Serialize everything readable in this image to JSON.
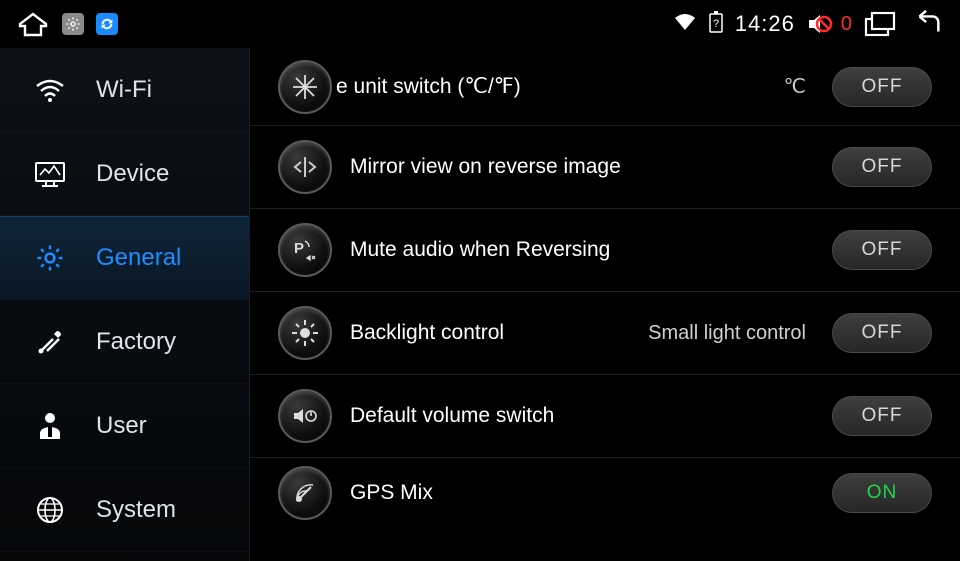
{
  "status": {
    "time": "14:26",
    "volume_count": "0"
  },
  "sidebar": {
    "items": [
      {
        "label": "Wi-Fi"
      },
      {
        "label": "Device"
      },
      {
        "label": "General"
      },
      {
        "label": "Factory"
      },
      {
        "label": "User"
      },
      {
        "label": "System"
      }
    ]
  },
  "settings": [
    {
      "label": "e unit switch (℃/℉)",
      "secondary": "℃",
      "value": "OFF",
      "on": false
    },
    {
      "label": "Mirror view on reverse image",
      "secondary": "",
      "value": "OFF",
      "on": false
    },
    {
      "label": "Mute audio when Reversing",
      "secondary": "",
      "value": "OFF",
      "on": false
    },
    {
      "label": "Backlight control",
      "secondary": "Small light control",
      "value": "OFF",
      "on": false
    },
    {
      "label": "Default volume switch",
      "secondary": "",
      "value": "OFF",
      "on": false
    },
    {
      "label": "GPS Mix",
      "secondary": "",
      "value": "ON",
      "on": true
    }
  ]
}
